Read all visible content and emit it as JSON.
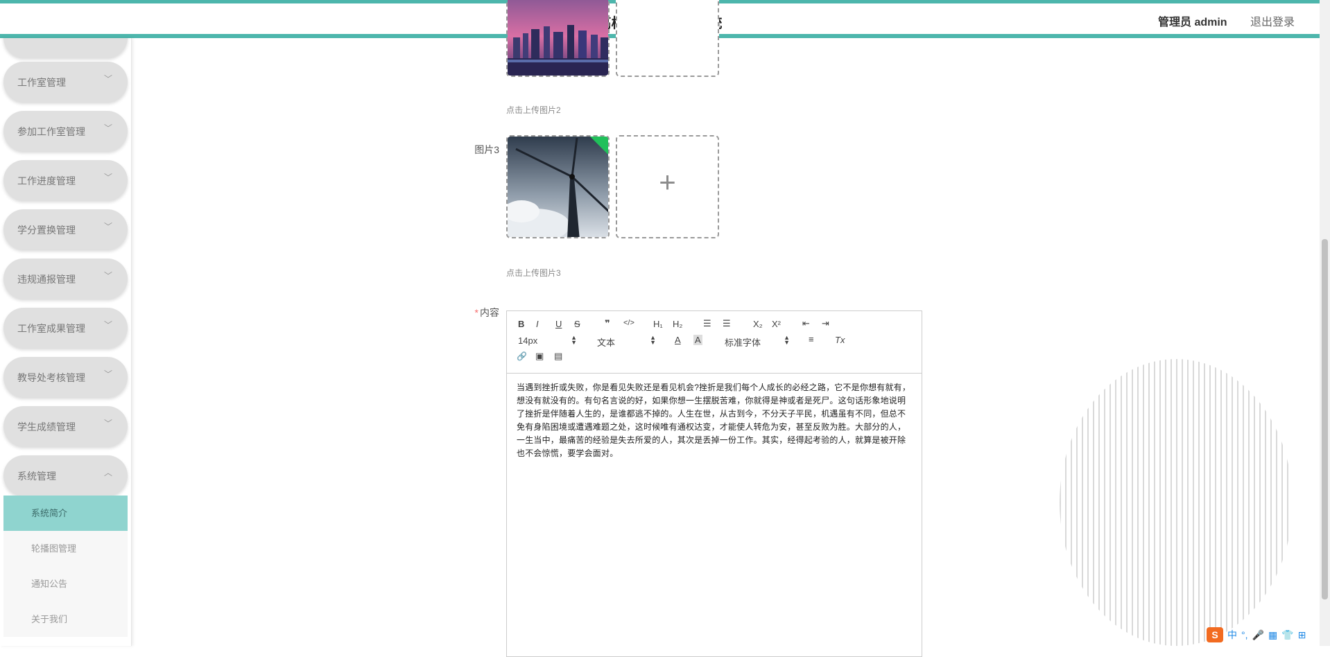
{
  "header": {
    "title": "高校工作室管理系统",
    "admin_label": "管理员 admin",
    "logout_label": "退出登录"
  },
  "sidebar": {
    "menus": [
      {
        "label": "工作室管理",
        "chevron": "chevron-down-icon"
      },
      {
        "label": "参加工作室管理",
        "chevron": "chevron-down-icon"
      },
      {
        "label": "工作进度管理",
        "chevron": "chevron-down-icon"
      },
      {
        "label": "学分置换管理",
        "chevron": "chevron-down-icon"
      },
      {
        "label": "违规通报管理",
        "chevron": "chevron-down-icon"
      },
      {
        "label": "工作室成果管理",
        "chevron": "chevron-down-icon"
      },
      {
        "label": "教导处考核管理",
        "chevron": "chevron-down-icon"
      },
      {
        "label": "学生成绩管理",
        "chevron": "chevron-down-icon"
      },
      {
        "label": "系统管理",
        "chevron": "chevron-up-icon"
      }
    ],
    "submenu": [
      {
        "label": "系统简介",
        "active": true
      },
      {
        "label": "轮播图管理",
        "active": false
      },
      {
        "label": "通知公告",
        "active": false
      },
      {
        "label": "关于我们",
        "active": false
      }
    ]
  },
  "form": {
    "image2_hint": "点击上传图片2",
    "image3_label": "图片3",
    "image3_hint": "点击上传图片3",
    "content_label": "内容",
    "required_mark": "*"
  },
  "editor": {
    "toolbar": {
      "bold": "B",
      "italic": "I",
      "underline": "U",
      "strike": "S",
      "quote": "❞",
      "code": "</>",
      "h1": "H₁",
      "h2": "H₂",
      "ordered": "☰",
      "bullet": "☰",
      "sub": "X₂",
      "sup": "X²",
      "outdent": "⇤",
      "indent": "⇥",
      "size": "14px",
      "header": "文本",
      "font_color": "A",
      "bg_color": "A",
      "font": "标准字体",
      "align": "≡",
      "clean": "Tx",
      "link": "🔗",
      "image": "▣",
      "video": "▤"
    },
    "content": "当遇到挫折或失败，你是看见失败还是看见机会?挫折是我们每个人成长的必经之路，它不是你想有就有，想没有就没有的。有句名言说的好，如果你想一生摆脱苦难，你就得是神或者是死尸。这句话形象地说明了挫折是伴随着人生的，是谁都逃不掉的。人生在世，从古到今，不分天子平民，机遇虽有不同，但总不免有身陷困境或遭遇难题之处，这时候唯有通权达变，才能使人转危为安，甚至反败为胜。大部分的人，一生当中，最痛苦的经验是失去所爱的人，其次是丢掉一份工作。其实，经得起考验的人，就算是被开除也不会惊慌，要学会面对。"
  },
  "ime": {
    "items": [
      "中",
      "°,",
      "🎤",
      "▦",
      "👕",
      "⊞"
    ]
  }
}
